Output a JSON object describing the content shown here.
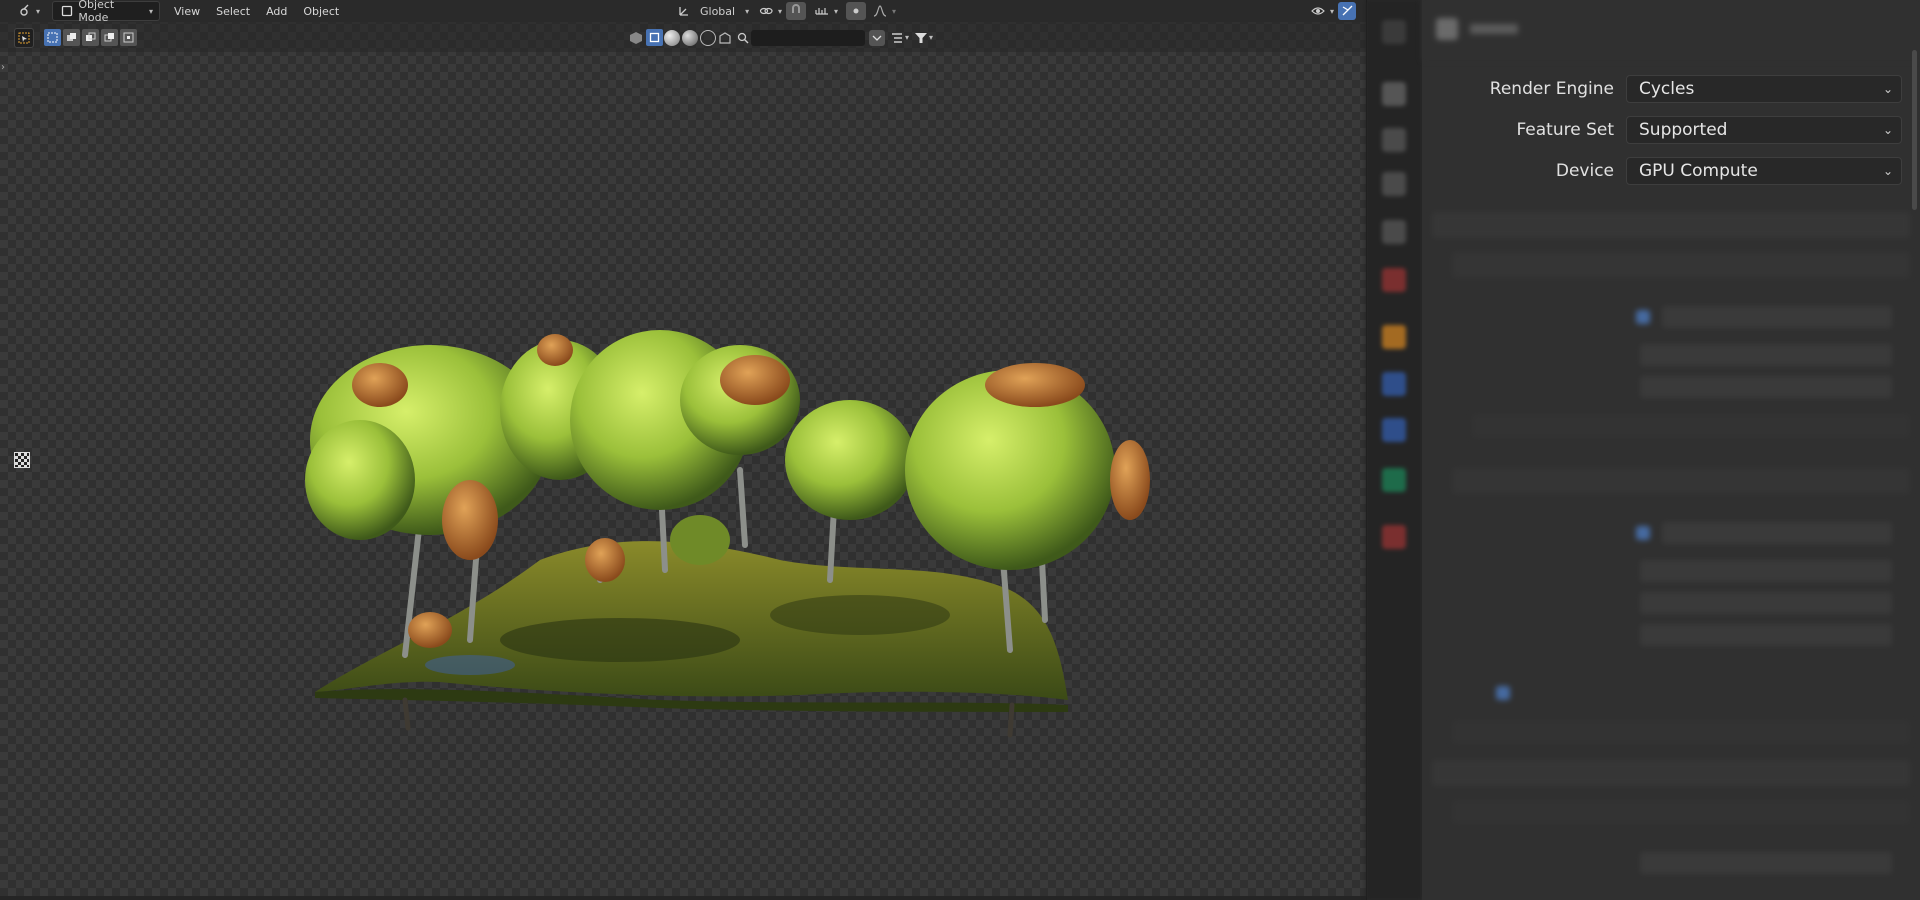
{
  "header": {
    "editor_icon": "viewport-editor-icon",
    "mode": "Object Mode",
    "menus": [
      "View",
      "Select",
      "Add",
      "Object"
    ],
    "transform_orientation": "Global"
  },
  "toolbar": {
    "select_modes": [
      "select-box",
      "select-extend",
      "select-subtract",
      "select-difference",
      "select-intersect"
    ],
    "search_placeholder": ""
  },
  "properties": {
    "rows": [
      {
        "label": "Render Engine",
        "value": "Cycles"
      },
      {
        "label": "Feature Set",
        "value": "Supported"
      },
      {
        "label": "Device",
        "value": "GPU Compute"
      }
    ]
  },
  "colors": {
    "accent": "#4772b3",
    "panel_bg": "#303030",
    "viewport_bg": "#3a3a3a"
  }
}
